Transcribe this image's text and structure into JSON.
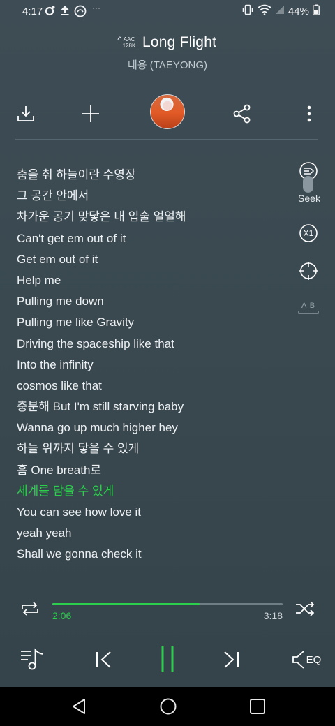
{
  "status_bar": {
    "time": "4:17",
    "battery": "44%"
  },
  "track": {
    "format_line1": "AAC",
    "format_line2": "128K",
    "title": "Long Flight",
    "artist": "태용 (TAEYONG)"
  },
  "actions": {
    "download_icon": "download-icon",
    "add_icon": "plus-icon",
    "share_icon": "share-icon",
    "more_icon": "more-vert-icon"
  },
  "lyrics": [
    "춤을 춰 하늘이란 수영장",
    "그 공간 안에서",
    "차가운 공기 맞닿은 내 입술 얼얼해",
    "Can't get em out of it",
    "Get em out of it",
    "Help me",
    "Pulling me down",
    "Pulling me like Gravity",
    "Driving the spaceship like that",
    "Into the infinity",
    "cosmos like that",
    "충분해 But I'm still starving baby",
    "Wanna go up much higher hey",
    "하늘 위까지 닿을 수 있게",
    "흠 One breath로",
    "세계를 담을 수 있게",
    "You can see how love it",
    "yeah yeah",
    "Shall we gonna check it"
  ],
  "current_lyric_index": 15,
  "side_tools": {
    "seek_label": "Seek",
    "speed_label": "X1",
    "ab_label": "A B"
  },
  "progress": {
    "current": "2:06",
    "total": "3:18",
    "fraction": 0.64
  },
  "controls": {
    "eq_label": "EQ"
  },
  "colors": {
    "accent": "#2ccf4c",
    "background": "#3a4950"
  }
}
